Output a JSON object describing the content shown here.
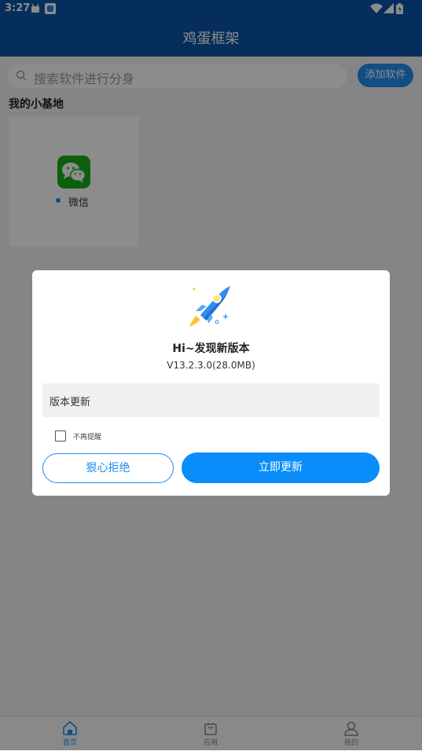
{
  "status_bar": {
    "time": "3:27"
  },
  "app_bar": {
    "title": "鸡蛋框架"
  },
  "search": {
    "placeholder": "搜索软件进行分身",
    "add_button": "添加软件"
  },
  "section": {
    "title": "我的小基地"
  },
  "apps": [
    {
      "name": "微信",
      "icon": "wechat-icon"
    }
  ],
  "bottom_nav": [
    {
      "label": "首页",
      "icon": "home-icon",
      "active": true
    },
    {
      "label": "应用",
      "icon": "bag-icon",
      "active": false
    },
    {
      "label": "我的",
      "icon": "user-icon",
      "active": false
    }
  ],
  "dialog": {
    "title": "Hi~发现新版本",
    "version": "V13.2.3.0(28.0MB)",
    "notes": "版本更新",
    "dont_remind": "不再提醒",
    "dont_remind_checked": false,
    "refuse_button": "狠心拒绝",
    "update_button": "立即更新"
  },
  "colors": {
    "primary": "#0a55a8",
    "accent": "#1e8ef0",
    "update_button": "#0a8dfa",
    "wechat": "#1aad19"
  }
}
